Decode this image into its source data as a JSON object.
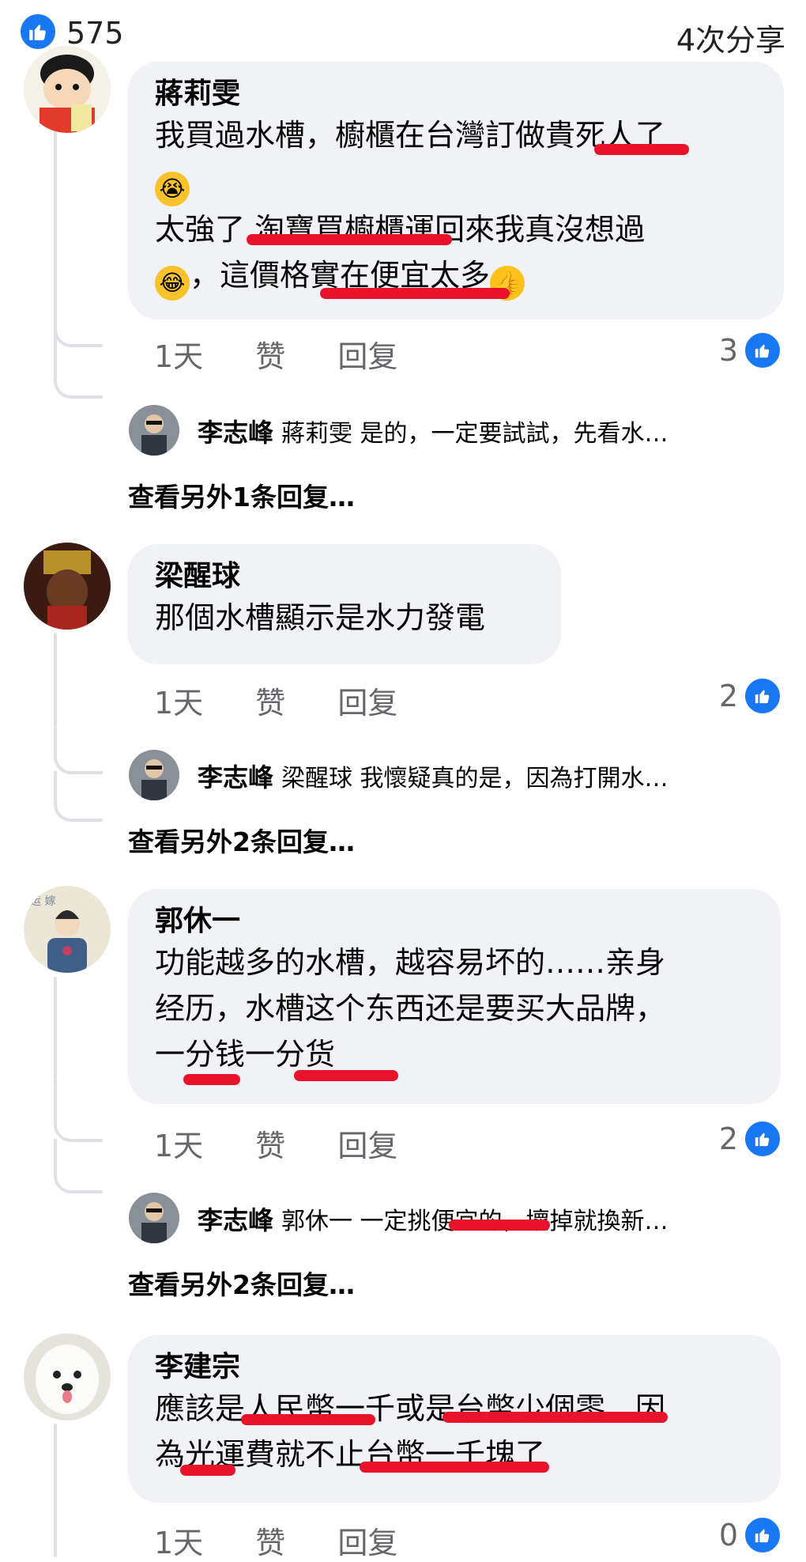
{
  "header": {
    "reaction_count": "575",
    "shares": "4次分享"
  },
  "comments": [
    {
      "author": "蔣莉雯",
      "lines": [
        "我買過水槽，櫥櫃在台灣訂做貴死人了",
        "",
        "太強了 淘寶買櫥櫃運回來我真沒想過",
        "，這價格實在便宜太多"
      ],
      "time": "1天",
      "like": "赞",
      "reply": "回复",
      "reactions": "3",
      "reply_author": "李志峰",
      "reply_text": "蔣莉雯 是的，一定要試試，先看水…",
      "more": "查看另外1条回复…"
    },
    {
      "author": "梁醒球",
      "lines": [
        "那個水槽顯示是水力發電"
      ],
      "time": "1天",
      "like": "赞",
      "reply": "回复",
      "reactions": "2",
      "reply_author": "李志峰",
      "reply_text": "梁醒球 我懷疑真的是，因為打開水…",
      "more": "查看另外2条回复…"
    },
    {
      "author": "郭休一",
      "lines": [
        "功能越多的水槽，越容易坏的……亲身",
        "经历，水槽这个东西还是要买大品牌，",
        "一分钱一分货"
      ],
      "time": "1天",
      "like": "赞",
      "reply": "回复",
      "reactions": "2",
      "reply_author": "李志峰",
      "reply_text": "郭休一 一定挑便宜的，壞掉就換新…",
      "more": "查看另外2条回复…"
    },
    {
      "author": "李建宗",
      "lines": [
        "應該是人民幣一千或是台幣少個零，因",
        "為光運費就不止台幣一千塊了"
      ],
      "time": "1天",
      "like": "赞",
      "reply": "回复",
      "reactions": "0"
    }
  ],
  "colors": {
    "brand": "#1877f2",
    "bubble": "#f0f2f5",
    "muted": "#65676b",
    "redaction": "#e8132a"
  },
  "icons": [
    "thumbs-up-icon",
    "crying-emoji",
    "laughing-emoji",
    "thumbs-up-emoji"
  ]
}
